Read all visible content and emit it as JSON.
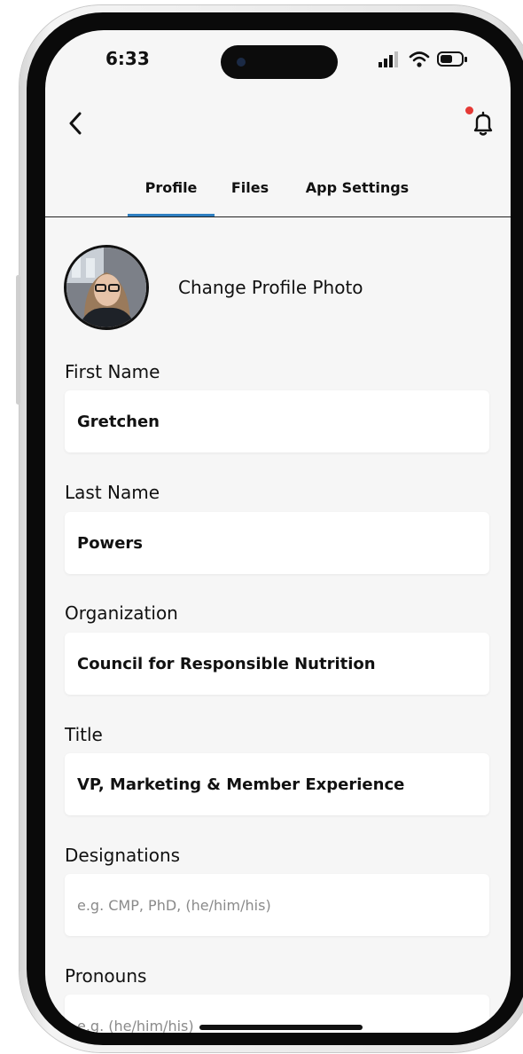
{
  "status_bar": {
    "time": "6:33",
    "icons": [
      "signal-icon",
      "wifi-icon",
      "battery-icon"
    ]
  },
  "header": {
    "back_icon": "chevron-left-icon",
    "notification_icon": "bell-icon",
    "notification_dot_color": "#e53935"
  },
  "tabs": [
    {
      "label": "Profile",
      "active": true
    },
    {
      "label": "Files",
      "active": false
    },
    {
      "label": "App Settings",
      "active": false
    }
  ],
  "accent_color": "#2f7fc1",
  "profile": {
    "change_photo_label": "Change Profile Photo"
  },
  "form": {
    "first_name": {
      "label": "First Name",
      "value": "Gretchen",
      "placeholder": ""
    },
    "last_name": {
      "label": "Last Name",
      "value": "Powers",
      "placeholder": ""
    },
    "organization": {
      "label": "Organization",
      "value": "Council for Responsible Nutrition",
      "placeholder": ""
    },
    "title": {
      "label": "Title",
      "value": "VP, Marketing & Member Experience",
      "placeholder": ""
    },
    "designations": {
      "label": "Designations",
      "value": "",
      "placeholder": "e.g. CMP, PhD, (he/him/his)"
    },
    "pronouns": {
      "label": "Pronouns",
      "value": "",
      "placeholder": "e.g. (he/him/his)"
    }
  }
}
